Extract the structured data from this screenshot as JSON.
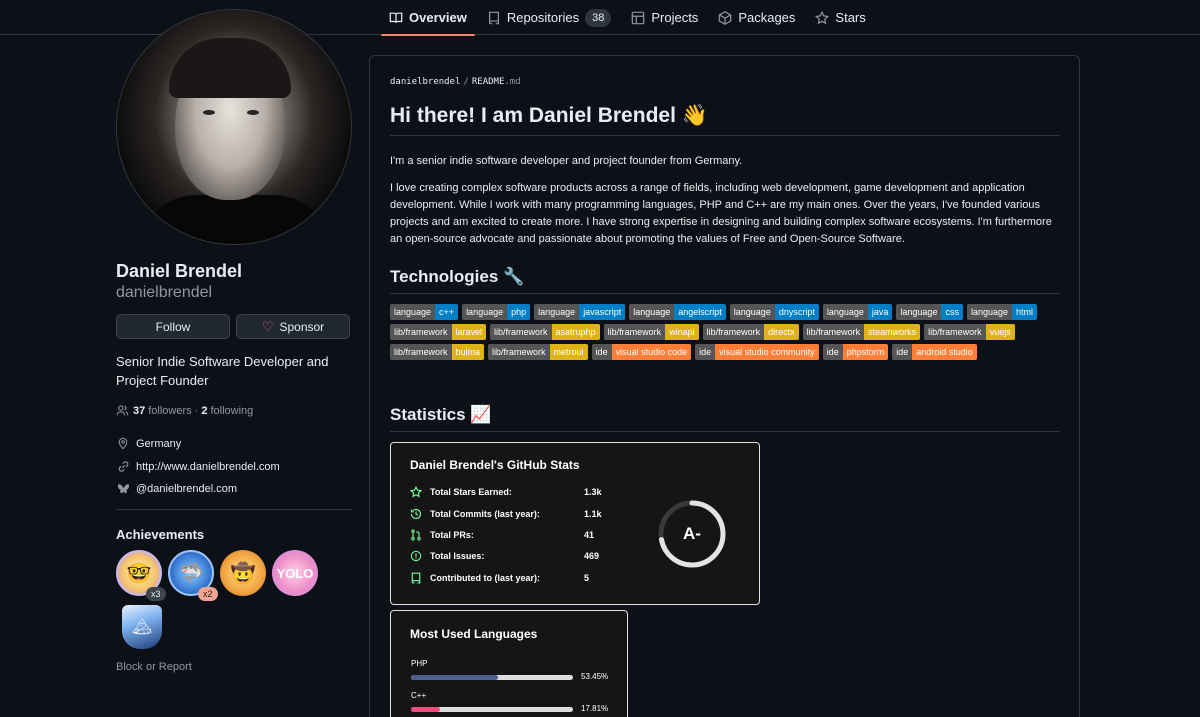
{
  "nav": {
    "tabs": [
      {
        "label": "Overview",
        "icon": "book-icon",
        "active": true
      },
      {
        "label": "Repositories",
        "icon": "repo-icon",
        "count": "38"
      },
      {
        "label": "Projects",
        "icon": "table-icon"
      },
      {
        "label": "Packages",
        "icon": "package-icon"
      },
      {
        "label": "Stars",
        "icon": "star-icon"
      }
    ]
  },
  "profile": {
    "name": "Daniel Brendel",
    "username": "danielbrendel",
    "follow_label": "Follow",
    "sponsor_label": "Sponsor",
    "bio": "Senior Indie Software Developer and Project Founder",
    "followers": "37",
    "followers_label": "followers",
    "following": "2",
    "following_label": "following",
    "location": "Germany",
    "website": "http://www.danielbrendel.com",
    "social": "@danielbrendel.com",
    "achievements_title": "Achievements",
    "achievements": [
      {
        "count": "x3",
        "icon": "pull-shark-icon"
      },
      {
        "count": "x2",
        "icon": "quickdraw-shark-icon"
      },
      {
        "count": "",
        "icon": "cowboy-icon"
      },
      {
        "count": "",
        "icon": "yolo-icon"
      },
      {
        "count": "",
        "icon": "arctic-vault-icon"
      }
    ],
    "block_label": "Block or Report"
  },
  "readme": {
    "crumb_user": "danielbrendel",
    "crumb_file": "README",
    "crumb_ext": ".md",
    "heading": "Hi there! I am Daniel Brendel 👋",
    "intro": "I'm a senior indie software developer and project founder from Germany.",
    "body": "I love creating complex software products across a range of fields, including web development, game development and application development. While I work with many programming languages, PHP and C++ are my main ones. Over the years, I've founded various projects and am excited to create more. I have strong expertise in designing and building complex software ecosystems. I'm furthermore an open-source advocate and passionate about promoting the values of Free and Open-Source Software.",
    "technologies_title": "Technologies 🔧",
    "statistics_title": "Statistics 📈",
    "shields": [
      {
        "k": "language",
        "v": "c++",
        "color": "#007ec6"
      },
      {
        "k": "language",
        "v": "php",
        "color": "#007ec6"
      },
      {
        "k": "language",
        "v": "javascript",
        "color": "#007ec6"
      },
      {
        "k": "language",
        "v": "angelscript",
        "color": "#007ec6"
      },
      {
        "k": "language",
        "v": "dnyscript",
        "color": "#007ec6"
      },
      {
        "k": "language",
        "v": "java",
        "color": "#007ec6"
      },
      {
        "k": "language",
        "v": "css",
        "color": "#007ec6"
      },
      {
        "k": "language",
        "v": "html",
        "color": "#007ec6"
      },
      {
        "k": "lib/framework",
        "v": "laravel",
        "color": "#dfb317"
      },
      {
        "k": "lib/framework",
        "v": "asatruphp",
        "color": "#dfb317"
      },
      {
        "k": "lib/framework",
        "v": "winapi",
        "color": "#dfb317"
      },
      {
        "k": "lib/framework",
        "v": "directx",
        "color": "#dfb317"
      },
      {
        "k": "lib/framework",
        "v": "steamworks",
        "color": "#dfb317"
      },
      {
        "k": "lib/framework",
        "v": "vuejs",
        "color": "#dfb317"
      },
      {
        "k": "lib/framework",
        "v": "bulma",
        "color": "#dfb317"
      },
      {
        "k": "lib/framework",
        "v": "metroui",
        "color": "#dfb317"
      },
      {
        "k": "ide",
        "v": "visual studio code",
        "color": "#fe7d37"
      },
      {
        "k": "ide",
        "v": "visual studio community",
        "color": "#fe7d37"
      },
      {
        "k": "ide",
        "v": "phpstorm",
        "color": "#fe7d37"
      },
      {
        "k": "ide",
        "v": "android studio",
        "color": "#fe7d37"
      }
    ]
  },
  "stats": {
    "title": "Daniel Brendel's GitHub Stats",
    "rows": [
      {
        "label": "Total Stars Earned:",
        "value": "1.3k",
        "icon": "star-icon"
      },
      {
        "label": "Total Commits (last year):",
        "value": "1.1k",
        "icon": "history-icon"
      },
      {
        "label": "Total PRs:",
        "value": "41",
        "icon": "pull-request-icon"
      },
      {
        "label": "Total Issues:",
        "value": "469",
        "icon": "issue-icon"
      },
      {
        "label": "Contributed to (last year):",
        "value": "5",
        "icon": "repo-icon"
      }
    ],
    "rank": "A-",
    "rank_progress": 0.72
  },
  "langs": {
    "title": "Most Used Languages",
    "items": [
      {
        "name": "PHP",
        "pct": "53.45%",
        "value": 53.45,
        "color": "#4F5D95"
      },
      {
        "name": "C++",
        "pct": "17.81%",
        "value": 17.81,
        "color": "#f34b7d"
      }
    ]
  }
}
